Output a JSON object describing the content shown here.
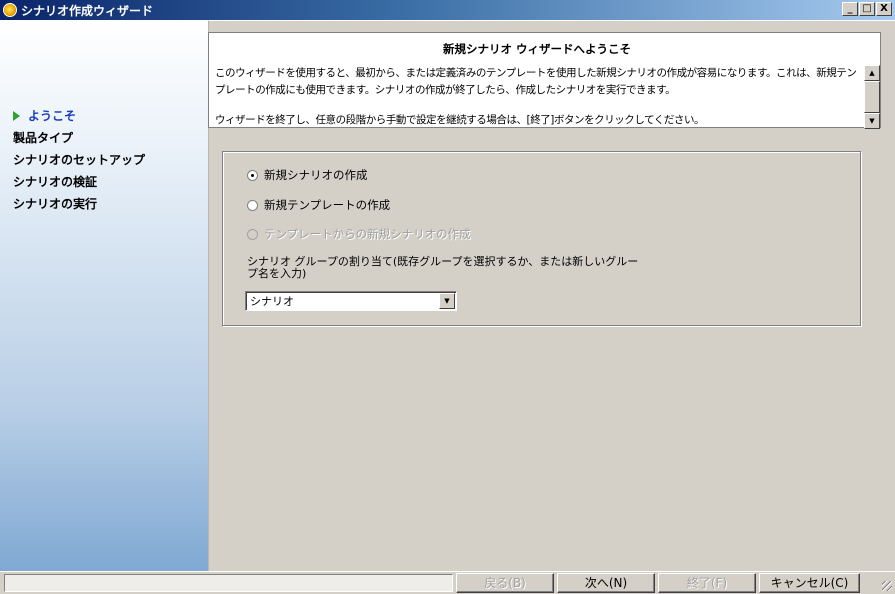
{
  "window": {
    "title": "シナリオ作成ウィザード",
    "minimize_label": "_",
    "maximize_label": "□",
    "close_label": "X"
  },
  "sidebar": {
    "items": [
      {
        "label": "ようこそ",
        "active": true
      },
      {
        "label": "製品タイプ"
      },
      {
        "label": "シナリオのセットアップ"
      },
      {
        "label": "シナリオの検証"
      },
      {
        "label": "シナリオの実行"
      }
    ]
  },
  "welcome": {
    "title": "新規シナリオ ウィザードへようこそ",
    "paragraph1": "このウィザードを使用すると、最初から、または定義済みのテンプレートを使用した新規シナリオの作成が容易になります。これは、新規テンプレートの作成にも使用できます。シナリオの作成が終了したら、作成したシナリオを実行できます。",
    "paragraph2": "ウィザードを終了し、任意の段階から手動で設定を継続する場合は、[終了]ボタンをクリックしてください。"
  },
  "options": {
    "radio1": {
      "label": "新規シナリオの作成",
      "checked": true
    },
    "radio2": {
      "label": "新規テンプレートの作成",
      "checked": false
    },
    "radio3": {
      "label": "テンプレートからの新規シナリオの作成",
      "disabled": true
    },
    "group_label": "シナリオ グループの割り当て(既存グループを選択するか、または新しいグループ名を入力)",
    "group_value": "シナリオ"
  },
  "buttons": {
    "back": "戻る(B)",
    "next": "次へ(N)",
    "finish": "終了(F)",
    "cancel": "キャンセル(C)"
  },
  "icons": [
    "app-icon",
    "nav-arrow-icon",
    "scroll-up-icon",
    "scroll-down-icon",
    "dropdown-arrow-icon",
    "resize-grip-icon"
  ]
}
